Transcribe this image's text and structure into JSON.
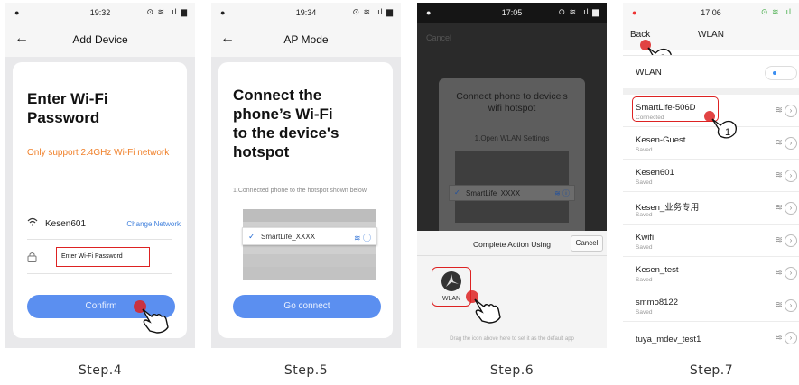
{
  "phones": [
    {
      "time": "19:32",
      "title": "Add Device",
      "heading_line1": "Enter Wi-Fi",
      "heading_line2": "Password",
      "notice": "Only support 2.4GHz Wi-Fi network",
      "wifi_name": "Kesen601",
      "change_network": "Change Network",
      "password_placeholder": "Enter Wi-Fi Password",
      "confirm": "Confirm",
      "step": "Step.4"
    },
    {
      "time": "19:34",
      "title": "AP Mode",
      "heading_line1": "Connect the",
      "heading_line2": "phone’s Wi-Fi",
      "heading_line3": "to the device's",
      "heading_line4": "hotspot",
      "instruction": "1.Connected phone to the hotspot shown below",
      "hotspot": "SmartLife_XXXX",
      "go_connect": "Go connect",
      "step": "Step.5"
    },
    {
      "time": "17:05",
      "cancel_top": "Cancel",
      "card_title": "Connect phone to device's wifi hotspot",
      "card_sub": "1.Open WLAN Settings",
      "hotspot": "SmartLife_XXXX",
      "sheet_title": "Complete Action Using",
      "sheet_cancel": "Cancel",
      "app_label": "WLAN",
      "hint": "Drag the icon above here to set it as the default app",
      "step": "Step.6"
    },
    {
      "time": "17:06",
      "back": "Back",
      "title": "WLAN",
      "wlan_label": "WLAN",
      "networks": [
        {
          "name": "SmartLife-506D",
          "status": "Connected"
        },
        {
          "name": "Kesen-Guest",
          "status": "Saved"
        },
        {
          "name": "Kesen601",
          "status": "Saved"
        },
        {
          "name": "Kesen_业务专用",
          "status": "Saved"
        },
        {
          "name": "Kwifi",
          "status": "Saved"
        },
        {
          "name": "Kesen_test",
          "status": "Saved"
        },
        {
          "name": "smmo8122",
          "status": "Saved"
        },
        {
          "name": "tuya_mdev_test1",
          "status": ""
        }
      ],
      "callout_1": "1",
      "callout_2": "2",
      "step": "Step.7"
    }
  ],
  "colors": {
    "accent_blue": "#5b8ff0",
    "highlight_red": "#d22222",
    "notice_orange": "#f0812b"
  },
  "icons": [
    "back-arrow-icon",
    "wifi-icon",
    "lock-icon",
    "checkmark-icon",
    "info-icon",
    "hand-pointer-icon",
    "wlan-app-icon"
  ]
}
